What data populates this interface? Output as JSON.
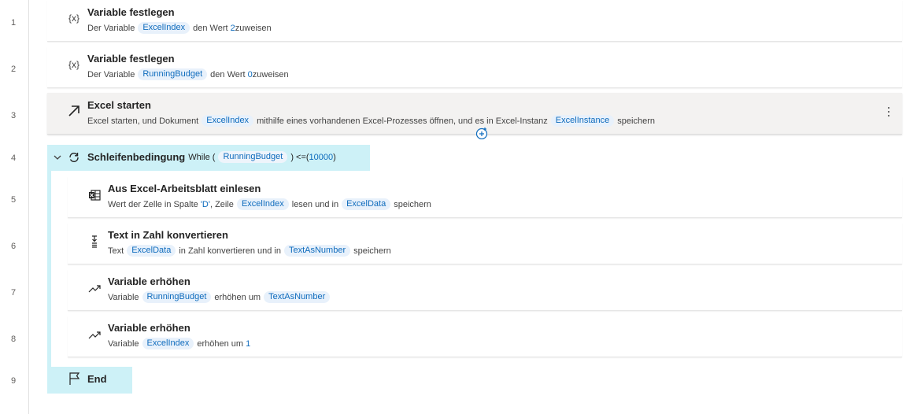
{
  "line_numbers": [
    "1",
    "2",
    "3",
    "4",
    "5",
    "6",
    "7",
    "8",
    "9"
  ],
  "actions": [
    {
      "title": "Variable festlegen",
      "icon": "{x}",
      "parts": [
        "Der Variable",
        "ExcelIndex",
        "den Wert",
        "2",
        "zuweisen"
      ]
    },
    {
      "title": "Variable festlegen",
      "icon": "{x}",
      "parts": [
        "Der Variable",
        "RunningBudget",
        "den Wert",
        "0",
        "zuweisen"
      ]
    },
    {
      "title": "Excel starten",
      "parts": [
        "Excel starten, und Dokument",
        "ExcelIndex",
        "mithilfe eines vorhandenen Excel-Prozesses öffnen, und es in Excel-Instanz",
        "ExcelInstance",
        "speichern"
      ]
    },
    {
      "title": "Schleifenbedingung",
      "parts": [
        "While (",
        "RunningBudget",
        ") <=(",
        "10000",
        ")"
      ]
    },
    {
      "title": "Aus Excel-Arbeitsblatt einlesen",
      "parts": [
        "Wert der Zelle in Spalte",
        "'D'",
        ", Zeile",
        "ExcelIndex",
        "lesen und in",
        "ExcelData",
        "speichern"
      ]
    },
    {
      "title": "Text in Zahl konvertieren",
      "parts": [
        "Text",
        "ExcelData",
        "in Zahl konvertieren und in",
        "TextAsNumber",
        "speichern"
      ]
    },
    {
      "title": "Variable erhöhen",
      "parts": [
        "Variable",
        "RunningBudget",
        "erhöhen um",
        "TextAsNumber"
      ]
    },
    {
      "title": "Variable erhöhen",
      "parts": [
        "Variable",
        "ExcelIndex",
        "erhöhen um",
        "1"
      ]
    },
    {
      "title": "End"
    }
  ],
  "colors": {
    "loop_bg": "#cdf1f7",
    "pill_bg": "#e8f1fb",
    "accent": "#0f6cbd",
    "selected_bg": "#f3f2f1"
  }
}
